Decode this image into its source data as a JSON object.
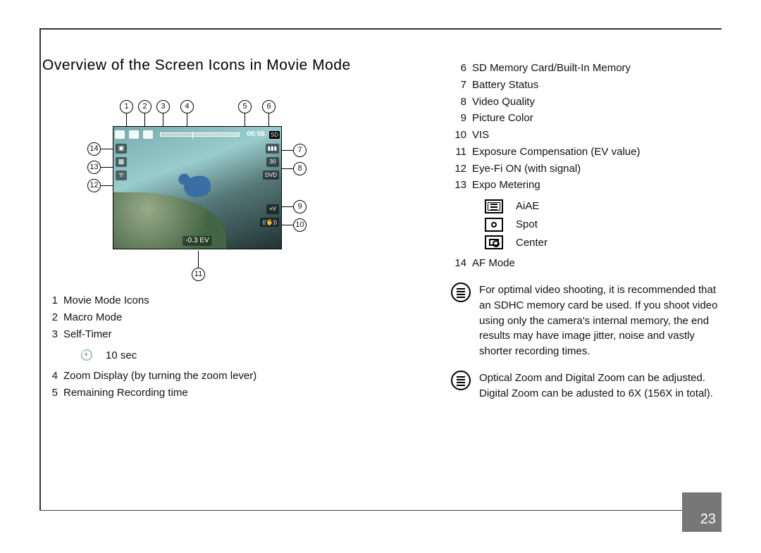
{
  "page": {
    "number": "23",
    "title": "Overview of the Screen Icons in Movie Mode"
  },
  "screen": {
    "rec_time": "00:56",
    "sd_badge": "SD",
    "fps_badge": "30",
    "dvd_badge": "DVD",
    "ev_text": "-0.3 EV",
    "vivid_badge": "+V",
    "hand_badge": "((🖐))"
  },
  "callouts": {
    "1": "1",
    "2": "2",
    "3": "3",
    "4": "4",
    "5": "5",
    "6": "6",
    "7": "7",
    "8": "8",
    "9": "9",
    "10": "10",
    "11": "11",
    "12": "12",
    "13": "13",
    "14": "14"
  },
  "left_list": [
    {
      "n": "1",
      "t": "Movie Mode Icons"
    },
    {
      "n": "2",
      "t": "Macro Mode"
    },
    {
      "n": "3",
      "t": "Self-Timer"
    }
  ],
  "left_sub": {
    "label": "10 sec"
  },
  "left_list2": [
    {
      "n": "4",
      "t": "Zoom Display (by turning the zoom lever)"
    },
    {
      "n": "5",
      "t": "Remaining Recording time"
    }
  ],
  "right_list": [
    {
      "n": "6",
      "t": "SD Memory Card/Built-In Memory"
    },
    {
      "n": "7",
      "t": "Battery Status"
    },
    {
      "n": "8",
      "t": "Video Quality"
    },
    {
      "n": "9",
      "t": "Picture Color"
    },
    {
      "n": "10",
      "t": "VIS"
    },
    {
      "n": "11",
      "t": "Exposure Compensation (EV value)"
    },
    {
      "n": "12",
      "t": "Eye-Fi ON (with signal)"
    },
    {
      "n": "13",
      "t": "Expo Metering"
    }
  ],
  "metering": [
    {
      "k": "aiae",
      "t": "AiAE"
    },
    {
      "k": "spot",
      "t": "Spot"
    },
    {
      "k": "center",
      "t": "Center"
    }
  ],
  "right_list2": [
    {
      "n": "14",
      "t": "AF Mode"
    }
  ],
  "notes": [
    "For optimal video shooting, it is recommended that an SDHC memory card be used. If you shoot video using only the camera's internal memory, the end results may have image jitter, noise and vastly shorter recording times.",
    "Optical Zoom and Digital Zoom can be adjusted. Digital Zoom can be adusted to 6X (156X in total)."
  ]
}
